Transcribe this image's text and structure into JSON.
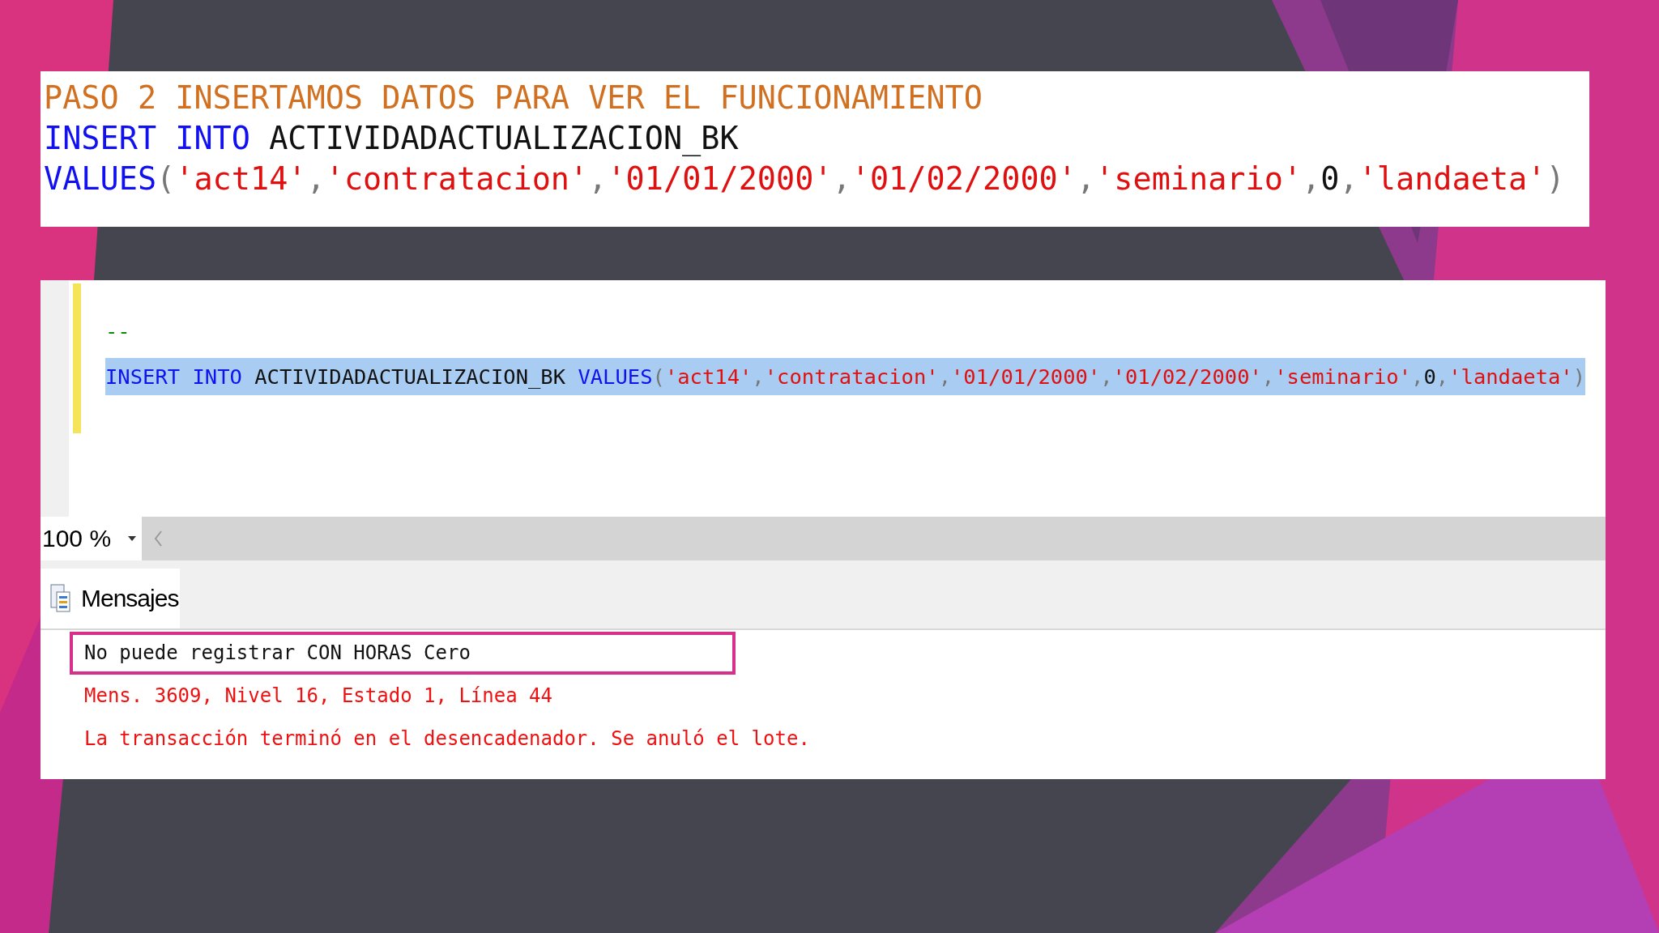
{
  "slide_code": {
    "lines": [
      [
        {
          "kind": "comment_heading",
          "text": "PASO 2 INSERTAMOS DATOS PARA VER EL FUNCIONAMIENTO"
        }
      ],
      [
        {
          "kind": "keyword",
          "text": "INSERT INTO"
        },
        {
          "kind": "plain",
          "text": " ACTIVIDADACTUALIZACION_BK"
        }
      ],
      [
        {
          "kind": "keyword",
          "text": "VALUES"
        },
        {
          "kind": "punct",
          "text": "("
        },
        {
          "kind": "string",
          "text": "'act14'"
        },
        {
          "kind": "punct",
          "text": ","
        },
        {
          "kind": "string",
          "text": "'contratacion'"
        },
        {
          "kind": "punct",
          "text": ","
        },
        {
          "kind": "string",
          "text": "'01/01/2000'"
        },
        {
          "kind": "punct",
          "text": ","
        },
        {
          "kind": "string",
          "text": "'01/02/2000'"
        },
        {
          "kind": "punct",
          "text": ","
        },
        {
          "kind": "string",
          "text": "'seminario'"
        },
        {
          "kind": "punct",
          "text": ","
        },
        {
          "kind": "plain",
          "text": "0"
        },
        {
          "kind": "punct",
          "text": ","
        },
        {
          "kind": "string",
          "text": "'landaeta'"
        },
        {
          "kind": "punct",
          "text": ")"
        }
      ]
    ]
  },
  "editor": {
    "lines": [
      {
        "selected": false,
        "tokens": [
          {
            "kind": "comment",
            "text": "--"
          }
        ]
      },
      {
        "selected": true,
        "tokens": [
          {
            "kind": "keyword",
            "text": "INSERT INTO"
          },
          {
            "kind": "plain",
            "text": " ACTIVIDADACTUALIZACION_BK "
          },
          {
            "kind": "keyword",
            "text": "VALUES"
          },
          {
            "kind": "punct",
            "text": "("
          },
          {
            "kind": "string",
            "text": "'act14'"
          },
          {
            "kind": "punct",
            "text": ","
          },
          {
            "kind": "string",
            "text": "'contratacion'"
          },
          {
            "kind": "punct",
            "text": ","
          },
          {
            "kind": "string",
            "text": "'01/01/2000'"
          },
          {
            "kind": "punct",
            "text": ","
          },
          {
            "kind": "string",
            "text": "'01/02/2000'"
          },
          {
            "kind": "punct",
            "text": ","
          },
          {
            "kind": "string",
            "text": "'seminario'"
          },
          {
            "kind": "punct",
            "text": ","
          },
          {
            "kind": "plain",
            "text": "0"
          },
          {
            "kind": "punct",
            "text": ","
          },
          {
            "kind": "string",
            "text": "'landaeta'"
          },
          {
            "kind": "punct",
            "text": ")"
          }
        ]
      }
    ],
    "zoom": "100 %"
  },
  "results": {
    "tabs": [
      {
        "label": "Mensajes",
        "selected": true
      }
    ],
    "messages": [
      {
        "kind": "info",
        "text": "No puede registrar CON HORAS Cero",
        "highlighted": true
      },
      {
        "kind": "error",
        "text": "Mens. 3609, Nivel 16, Estado 1, Línea 44",
        "highlighted": false
      },
      {
        "kind": "error",
        "text": "La transacción terminó en el desencadenador. Se anuló el lote.",
        "highlighted": false
      }
    ]
  }
}
